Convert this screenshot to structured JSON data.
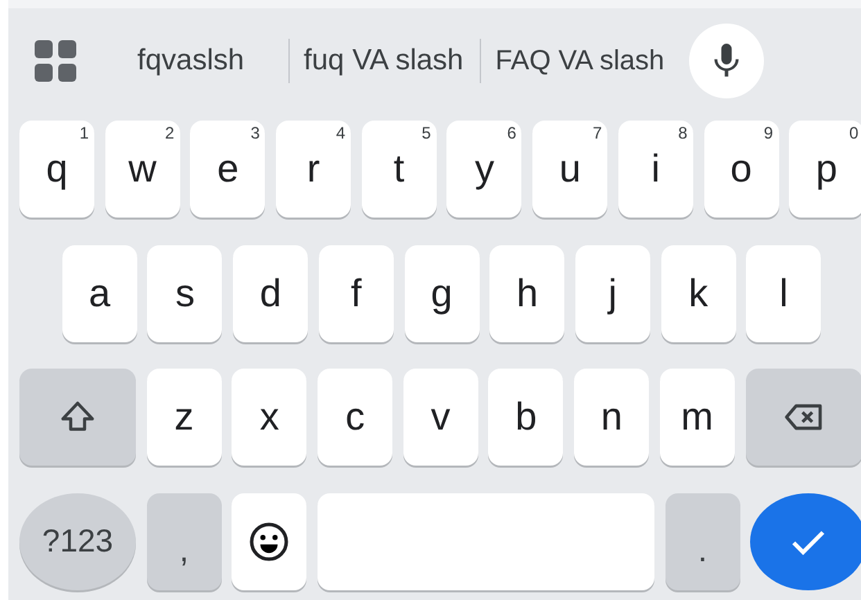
{
  "suggestions": [
    {
      "text": "fqvaslsh"
    },
    {
      "text": "fuq VA slash"
    },
    {
      "text": "FAQ VA slash"
    }
  ],
  "rows": [
    {
      "keys": [
        {
          "kind": "letter",
          "label": "q",
          "hint": "1"
        },
        {
          "kind": "letter",
          "label": "w",
          "hint": "2"
        },
        {
          "kind": "letter",
          "label": "e",
          "hint": "3"
        },
        {
          "kind": "letter",
          "label": "r",
          "hint": "4"
        },
        {
          "kind": "letter",
          "label": "t",
          "hint": "5"
        },
        {
          "kind": "letter",
          "label": "y",
          "hint": "6"
        },
        {
          "kind": "letter",
          "label": "u",
          "hint": "7"
        },
        {
          "kind": "letter",
          "label": "i",
          "hint": "8"
        },
        {
          "kind": "letter",
          "label": "o",
          "hint": "9"
        },
        {
          "kind": "letter",
          "label": "p",
          "hint": "0"
        }
      ]
    },
    {
      "keys": [
        {
          "kind": "letter",
          "label": "a"
        },
        {
          "kind": "letter",
          "label": "s"
        },
        {
          "kind": "letter",
          "label": "d"
        },
        {
          "kind": "letter",
          "label": "f"
        },
        {
          "kind": "letter",
          "label": "g"
        },
        {
          "kind": "letter",
          "label": "h"
        },
        {
          "kind": "letter",
          "label": "j"
        },
        {
          "kind": "letter",
          "label": "k"
        },
        {
          "kind": "letter",
          "label": "l"
        }
      ]
    },
    {
      "keys": [
        {
          "kind": "shift"
        },
        {
          "kind": "letter",
          "label": "z"
        },
        {
          "kind": "letter",
          "label": "x"
        },
        {
          "kind": "letter",
          "label": "c"
        },
        {
          "kind": "letter",
          "label": "v"
        },
        {
          "kind": "letter",
          "label": "b"
        },
        {
          "kind": "letter",
          "label": "n"
        },
        {
          "kind": "letter",
          "label": "m"
        },
        {
          "kind": "backspace"
        }
      ]
    },
    {
      "keys": [
        {
          "kind": "symbols",
          "label": "?123"
        },
        {
          "kind": "punct",
          "label": ","
        },
        {
          "kind": "emoji"
        },
        {
          "kind": "space"
        },
        {
          "kind": "punct",
          "label": "."
        },
        {
          "kind": "enter"
        }
      ]
    }
  ]
}
